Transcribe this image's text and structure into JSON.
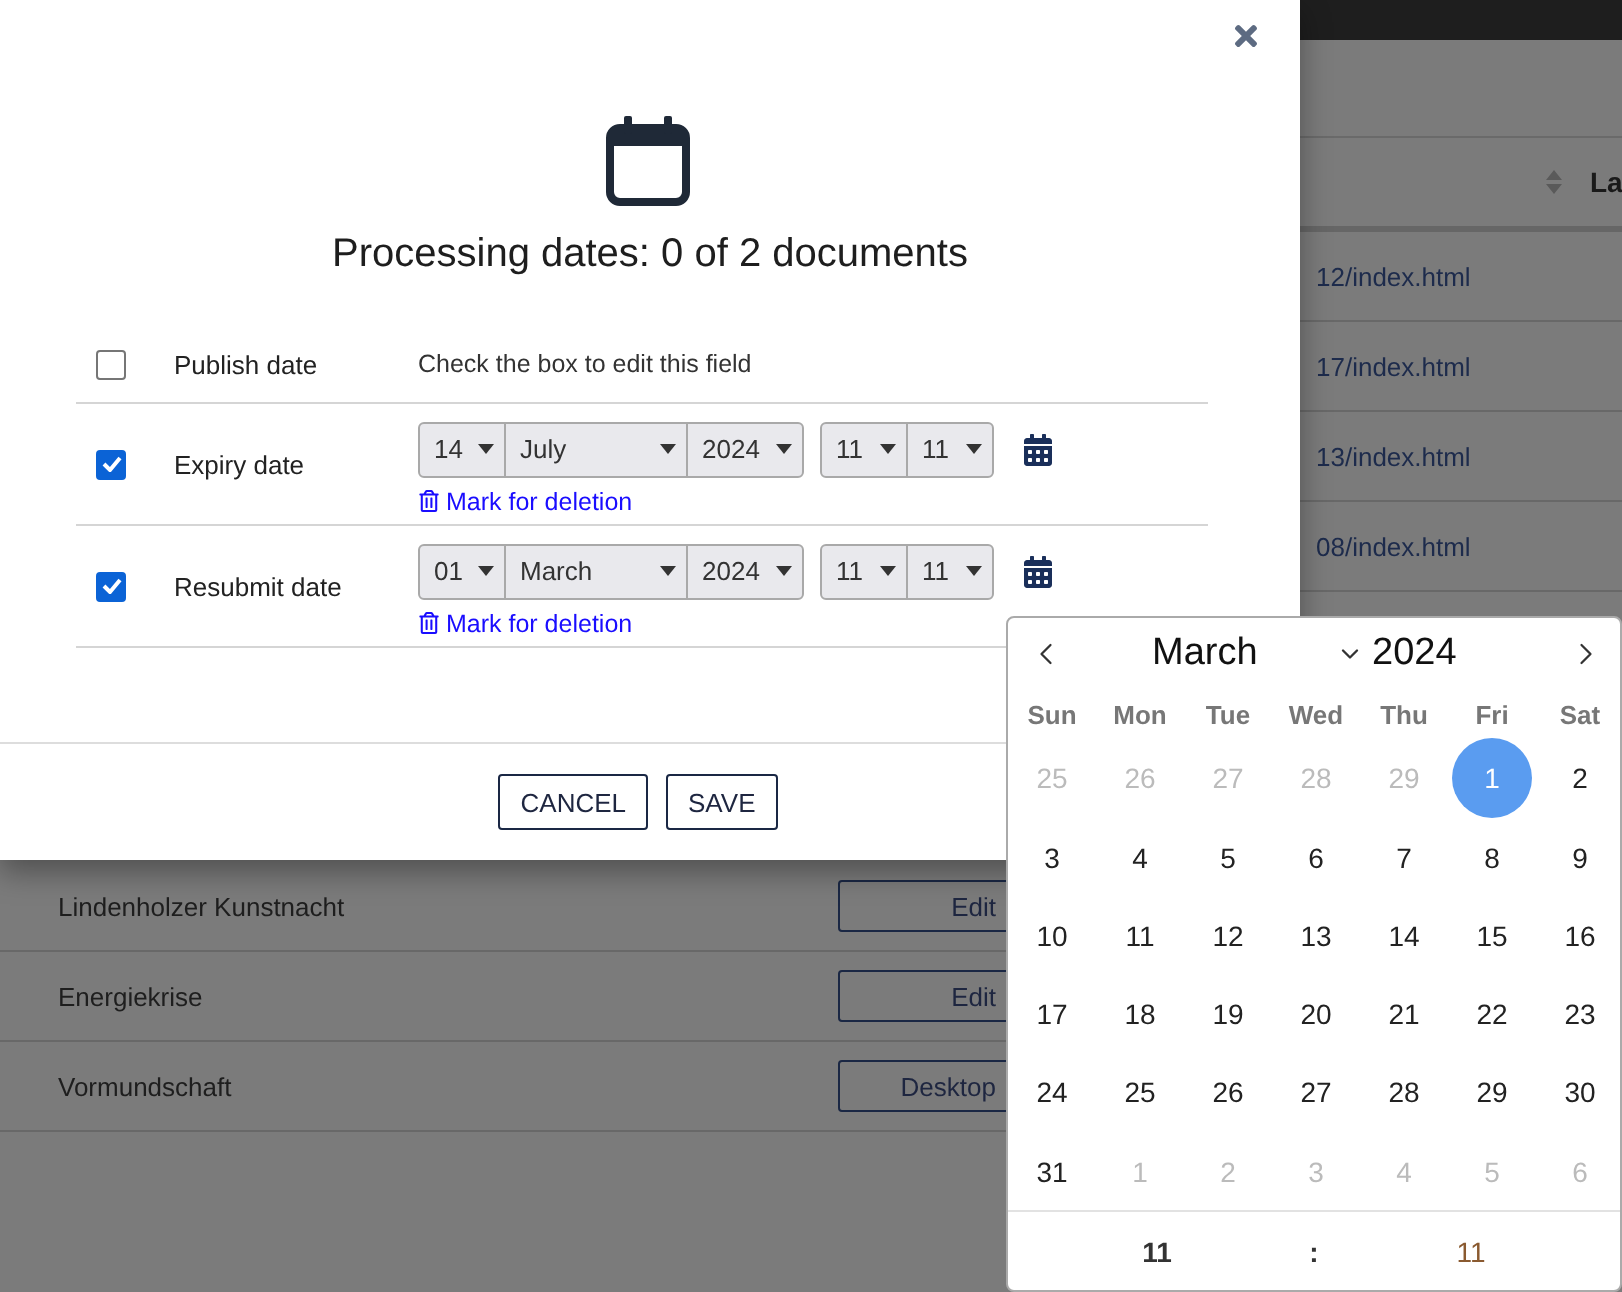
{
  "background": {
    "header_column": "La",
    "link_rows": [
      "12/index.html",
      "17/index.html",
      "13/index.html",
      "08/index.html"
    ],
    "rows": [
      {
        "name": "Lindenholzer Kunstnacht",
        "action": "Edit"
      },
      {
        "name": "Energiekrise",
        "action": "Edit"
      },
      {
        "name": "Vormundschaft",
        "action": "Desktop"
      }
    ]
  },
  "dialog": {
    "title": "Processing dates: 0 of 2 documents",
    "fields": [
      {
        "kind": "hint",
        "label": "Publish date",
        "checked": false,
        "hint": "Check the box to edit this field"
      },
      {
        "kind": "date",
        "label": "Expiry date",
        "checked": true,
        "day": "14",
        "month": "July",
        "year": "2024",
        "hour": "11",
        "minute": "11",
        "delete_link": "Mark for deletion"
      },
      {
        "kind": "date",
        "label": "Resubmit date",
        "checked": true,
        "day": "01",
        "month": "March",
        "year": "2024",
        "hour": "11",
        "minute": "11",
        "delete_link": "Mark for deletion"
      }
    ],
    "buttons": [
      "CANCEL",
      "SAVE"
    ]
  },
  "datepicker": {
    "month": "March",
    "year": "2024",
    "weekdays": [
      "Sun",
      "Mon",
      "Tue",
      "Wed",
      "Thu",
      "Fri",
      "Sat"
    ],
    "weeks": [
      [
        {
          "day": "25",
          "outside": true,
          "selected": false
        },
        {
          "day": "26",
          "outside": true,
          "selected": false
        },
        {
          "day": "27",
          "outside": true,
          "selected": false
        },
        {
          "day": "28",
          "outside": true,
          "selected": false
        },
        {
          "day": "29",
          "outside": true,
          "selected": false
        },
        {
          "day": "1",
          "outside": false,
          "selected": true
        },
        {
          "day": "2",
          "outside": false,
          "selected": false
        }
      ],
      [
        {
          "day": "3",
          "outside": false,
          "selected": false
        },
        {
          "day": "4",
          "outside": false,
          "selected": false
        },
        {
          "day": "5",
          "outside": false,
          "selected": false
        },
        {
          "day": "6",
          "outside": false,
          "selected": false
        },
        {
          "day": "7",
          "outside": false,
          "selected": false
        },
        {
          "day": "8",
          "outside": false,
          "selected": false
        },
        {
          "day": "9",
          "outside": false,
          "selected": false
        }
      ],
      [
        {
          "day": "10",
          "outside": false,
          "selected": false
        },
        {
          "day": "11",
          "outside": false,
          "selected": false
        },
        {
          "day": "12",
          "outside": false,
          "selected": false
        },
        {
          "day": "13",
          "outside": false,
          "selected": false
        },
        {
          "day": "14",
          "outside": false,
          "selected": false
        },
        {
          "day": "15",
          "outside": false,
          "selected": false
        },
        {
          "day": "16",
          "outside": false,
          "selected": false
        }
      ],
      [
        {
          "day": "17",
          "outside": false,
          "selected": false
        },
        {
          "day": "18",
          "outside": false,
          "selected": false
        },
        {
          "day": "19",
          "outside": false,
          "selected": false
        },
        {
          "day": "20",
          "outside": false,
          "selected": false
        },
        {
          "day": "21",
          "outside": false,
          "selected": false
        },
        {
          "day": "22",
          "outside": false,
          "selected": false
        },
        {
          "day": "23",
          "outside": false,
          "selected": false
        }
      ],
      [
        {
          "day": "24",
          "outside": false,
          "selected": false
        },
        {
          "day": "25",
          "outside": false,
          "selected": false
        },
        {
          "day": "26",
          "outside": false,
          "selected": false
        },
        {
          "day": "27",
          "outside": false,
          "selected": false
        },
        {
          "day": "28",
          "outside": false,
          "selected": false
        },
        {
          "day": "29",
          "outside": false,
          "selected": false
        },
        {
          "day": "30",
          "outside": false,
          "selected": false
        }
      ],
      [
        {
          "day": "31",
          "outside": false,
          "selected": false
        },
        {
          "day": "1",
          "outside": true,
          "selected": false
        },
        {
          "day": "2",
          "outside": true,
          "selected": false
        },
        {
          "day": "3",
          "outside": true,
          "selected": false
        },
        {
          "day": "4",
          "outside": true,
          "selected": false
        },
        {
          "day": "5",
          "outside": true,
          "selected": false
        },
        {
          "day": "6",
          "outside": true,
          "selected": false
        }
      ]
    ],
    "hour": "11",
    "separator": ":",
    "minute": "11"
  }
}
